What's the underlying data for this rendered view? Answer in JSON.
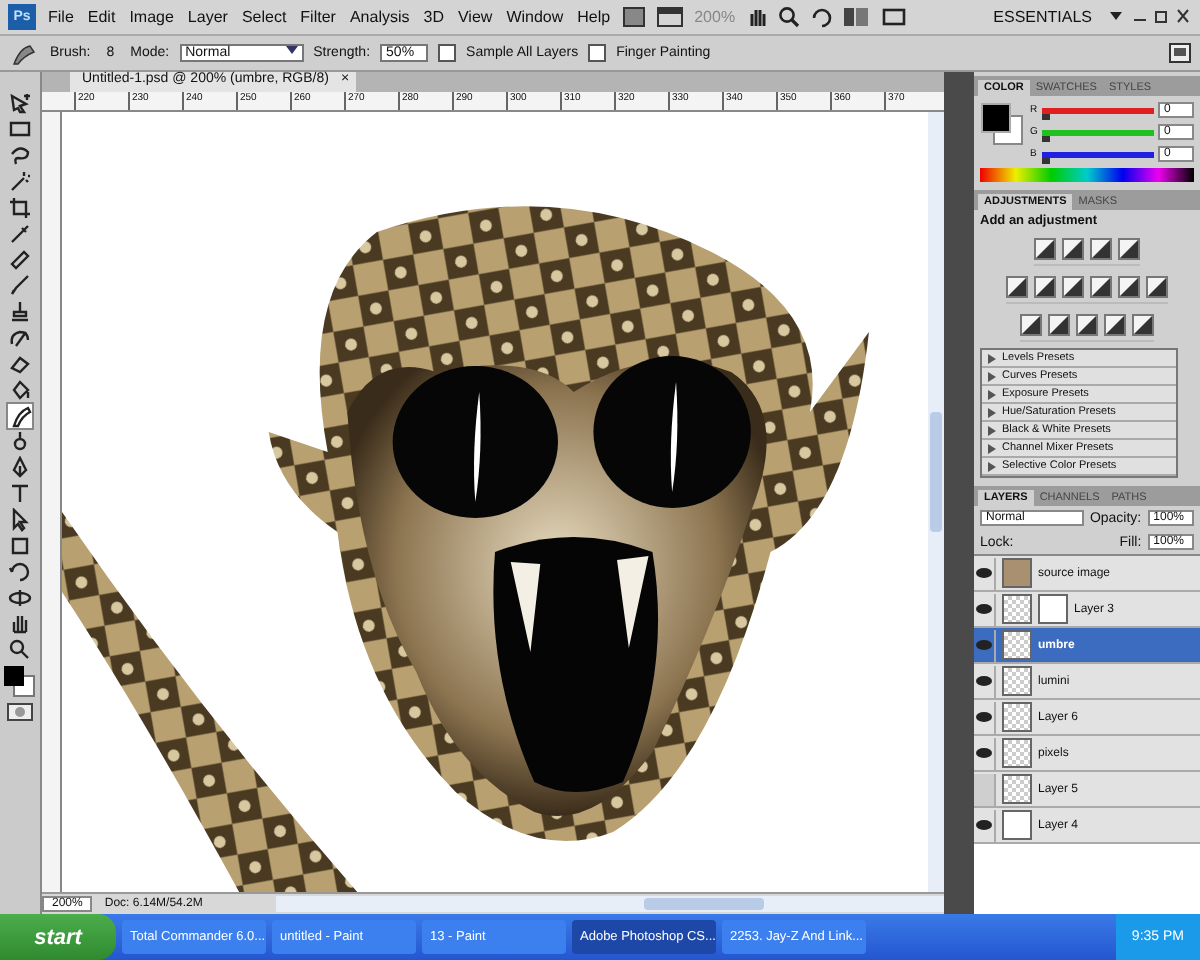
{
  "menu_bar": {
    "logo": "Ps",
    "items": [
      "File",
      "Edit",
      "Image",
      "Layer",
      "Select",
      "Filter",
      "Analysis",
      "3D",
      "View",
      "Window",
      "Help"
    ],
    "zoom": "200%",
    "workspace": "ESSENTIALS"
  },
  "options_bar": {
    "brush_label": "Brush:",
    "brush_size": "8",
    "mode_label": "Mode:",
    "mode": "Normal",
    "strength_label": "Strength:",
    "strength": "50%",
    "checkboxes": [
      {
        "label": "Sample All Layers",
        "checked": false
      },
      {
        "label": "Finger Painting",
        "checked": false
      }
    ]
  },
  "document_tab": {
    "title": "Untitled-1.psd @ 200% (umbre, RGB/8)",
    "close": "×"
  },
  "ruler": [
    "220",
    "230",
    "240",
    "250",
    "260",
    "270",
    "280",
    "290",
    "300",
    "310",
    "320",
    "330",
    "340",
    "350",
    "360",
    "370"
  ],
  "tools": [
    {
      "kind": "move",
      "selected": false
    },
    {
      "kind": "marquee",
      "selected": false
    },
    {
      "kind": "lasso",
      "selected": false
    },
    {
      "kind": "wand",
      "selected": false
    },
    {
      "kind": "crop",
      "selected": false
    },
    {
      "kind": "eyedropper",
      "selected": false
    },
    {
      "kind": "healing",
      "selected": false
    },
    {
      "kind": "brush",
      "selected": false
    },
    {
      "kind": "stamp",
      "selected": false
    },
    {
      "kind": "history",
      "selected": false
    },
    {
      "kind": "eraser",
      "selected": false
    },
    {
      "kind": "bucket",
      "selected": false
    },
    {
      "kind": "smudge",
      "selected": true
    },
    {
      "kind": "dodge",
      "selected": false
    },
    {
      "kind": "pen",
      "selected": false
    },
    {
      "kind": "type",
      "selected": false
    },
    {
      "kind": "select",
      "selected": false
    },
    {
      "kind": "shape",
      "selected": false
    },
    {
      "kind": "rotate",
      "selected": false
    },
    {
      "kind": "orbit",
      "selected": false
    },
    {
      "kind": "hand",
      "selected": false
    },
    {
      "kind": "zoom",
      "selected": false
    }
  ],
  "color_panel": {
    "tabs": [
      {
        "label": "COLOR",
        "selected": true
      },
      {
        "label": "SWATCHES",
        "selected": false
      },
      {
        "label": "STYLES",
        "selected": false
      }
    ],
    "channels": [
      {
        "label": "R",
        "value": "0",
        "level": 0,
        "color": "#e02020"
      },
      {
        "label": "G",
        "value": "0",
        "level": 0,
        "color": "#20c020"
      },
      {
        "label": "B",
        "value": "0",
        "level": 0,
        "color": "#2020e0"
      }
    ]
  },
  "adjustments_panel": {
    "tabs": [
      {
        "label": "ADJUSTMENTS",
        "selected": true
      },
      {
        "label": "MASKS",
        "selected": false
      }
    ],
    "heading": "Add an adjustment",
    "presets": [
      "Levels Presets",
      "Curves Presets",
      "Exposure Presets",
      "Hue/Saturation Presets",
      "Black & White Presets",
      "Channel Mixer Presets",
      "Selective Color Presets"
    ]
  },
  "layers_panel": {
    "tabs": [
      {
        "label": "LAYERS",
        "selected": true
      },
      {
        "label": "CHANNELS",
        "selected": false
      },
      {
        "label": "PATHS",
        "selected": false
      }
    ],
    "blend_mode": "Normal",
    "opacity_label": "Opacity:",
    "opacity": "100%",
    "lock_label": "Lock:",
    "fill_label": "Fill:",
    "fill": "100%",
    "layers": [
      {
        "name": "source image",
        "visible": true,
        "selected": false,
        "kind": "image"
      },
      {
        "name": "Layer 3",
        "visible": true,
        "selected": false,
        "kind": "masked"
      },
      {
        "name": "umbre",
        "visible": true,
        "selected": true,
        "kind": "transparent"
      },
      {
        "name": "lumini",
        "visible": true,
        "selected": false,
        "kind": "transparent"
      },
      {
        "name": "Layer 6",
        "visible": true,
        "selected": false,
        "kind": "transparent"
      },
      {
        "name": "pixels",
        "visible": true,
        "selected": false,
        "kind": "transparent"
      },
      {
        "name": "Layer 5",
        "visible": false,
        "selected": false,
        "kind": "transparent"
      },
      {
        "name": "Layer 4",
        "visible": true,
        "selected": false,
        "kind": "white"
      }
    ]
  },
  "status_bar": {
    "zoom": "200%",
    "doc": "Doc: 6.14M/54.2M"
  },
  "taskbar": {
    "start": "start",
    "items": [
      {
        "label": "Total Commander 6.0...",
        "selected": false
      },
      {
        "label": "untitled - Paint",
        "selected": false
      },
      {
        "label": "13 - Paint",
        "selected": false
      },
      {
        "label": "Adobe Photoshop CS...",
        "selected": true
      },
      {
        "label": "2253. Jay-Z And Link...",
        "selected": false
      }
    ],
    "clock": "9:35 PM"
  }
}
